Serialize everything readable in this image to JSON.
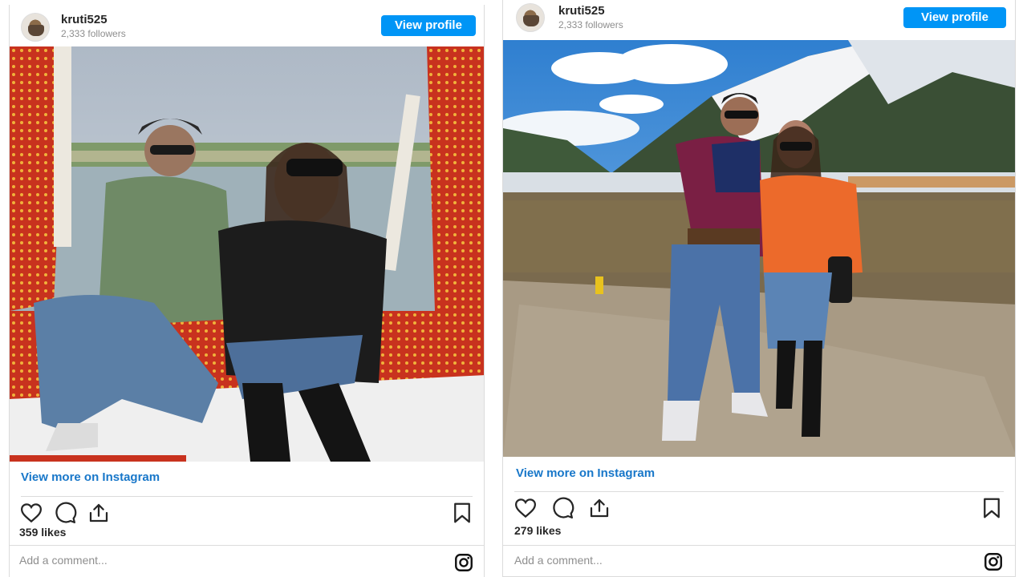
{
  "posts": [
    {
      "username": "kruti525",
      "followers": "2,333 followers",
      "view_profile": "View profile",
      "view_more": "View more on Instagram",
      "likes": "359 likes",
      "comment_placeholder": "Add a comment...",
      "photo_alt": "Couple on shikara boat on lake"
    },
    {
      "username": "kruti525",
      "followers": "2,333 followers",
      "view_profile": "View profile",
      "view_more": "View more on Instagram",
      "likes": "279 likes",
      "comment_placeholder": "Add a comment...",
      "photo_alt": "Couple standing in snowy mountain valley"
    }
  ],
  "icons": [
    "heart-icon",
    "comment-icon",
    "share-icon",
    "bookmark-icon",
    "instagram-icon"
  ],
  "colors": {
    "accent": "#0095f6",
    "link": "#1877c9",
    "muted": "#8e8e8e"
  }
}
